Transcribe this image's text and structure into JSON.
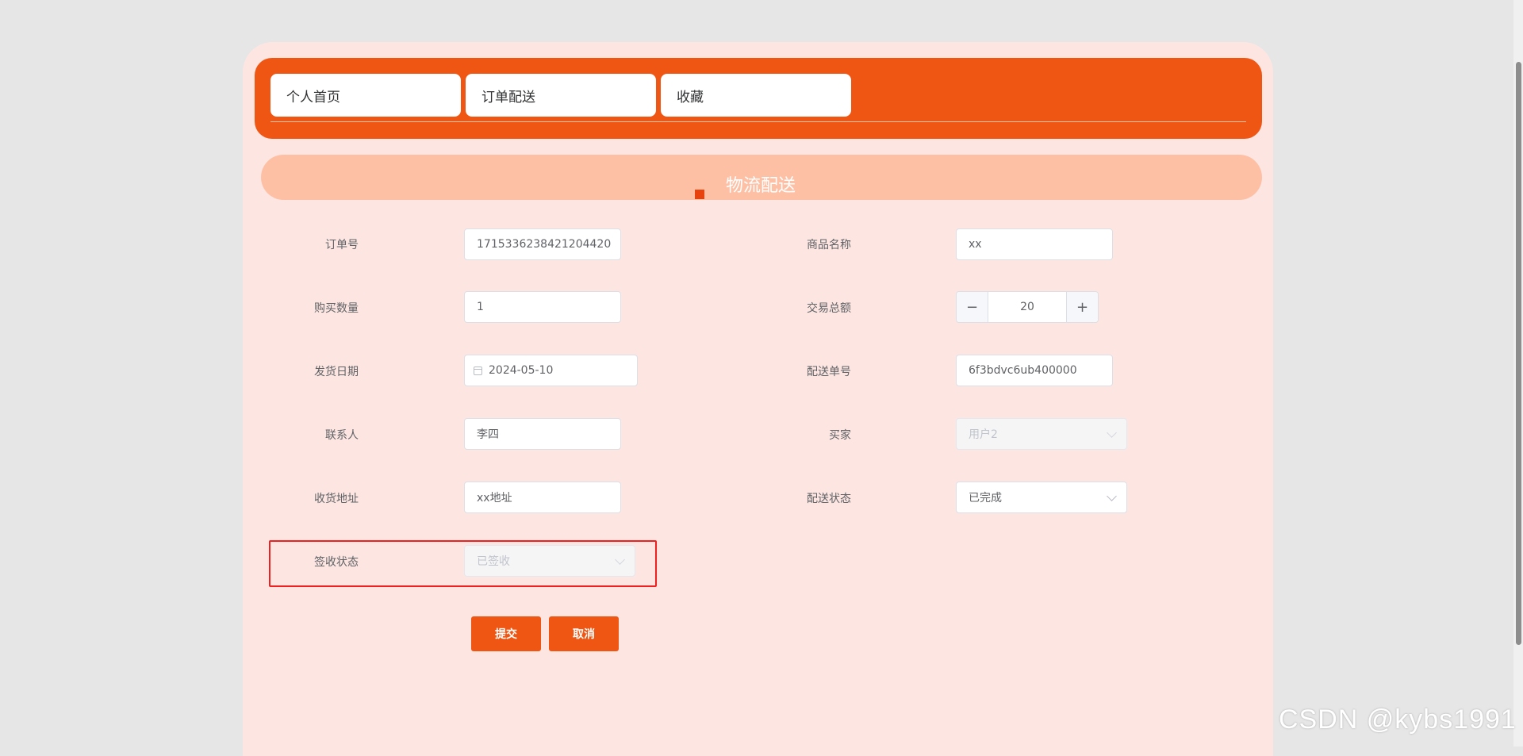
{
  "nav": {
    "tabs": [
      {
        "label": "个人首页"
      },
      {
        "label": "订单配送"
      },
      {
        "label": "收藏"
      }
    ]
  },
  "section": {
    "title": "物流配送"
  },
  "form": {
    "order_no": {
      "label": "订单号",
      "value": "1715336238421204420"
    },
    "product_name": {
      "label": "商品名称",
      "value": "xx"
    },
    "quantity": {
      "label": "购买数量",
      "value": "1"
    },
    "total": {
      "label": "交易总额",
      "value": "20",
      "minus": "−",
      "plus": "+"
    },
    "ship_date": {
      "label": "发货日期",
      "value": "2024-05-10"
    },
    "delivery_no": {
      "label": "配送单号",
      "value": "6f3bdvc6ub400000"
    },
    "contact": {
      "label": "联系人",
      "value": "李四"
    },
    "buyer": {
      "label": "买家",
      "value": "用户2",
      "disabled": true
    },
    "address": {
      "label": "收货地址",
      "value": "xx地址"
    },
    "delivery_status": {
      "label": "配送状态",
      "value": "已完成"
    },
    "sign_status": {
      "label": "签收状态",
      "value": "已签收",
      "disabled": true
    }
  },
  "buttons": {
    "submit": "提交",
    "cancel": "取消"
  },
  "watermark": "CSDN @kybs1991",
  "colors": {
    "accent": "#ef5613",
    "panel": "#fde6e2",
    "header": "#fdc0a5",
    "highlight": "#f02020"
  }
}
